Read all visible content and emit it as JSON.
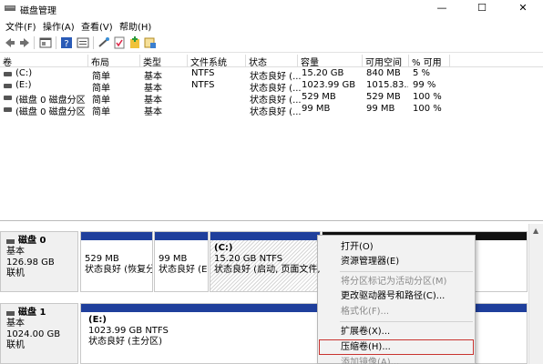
{
  "window": {
    "title": "磁盘管理",
    "controls": {
      "minimize": "—",
      "maximize": "☐",
      "close": "✕"
    }
  },
  "menubar": [
    "文件(F)",
    "操作(A)",
    "查看(V)",
    "帮助(H)"
  ],
  "toolbar_icons": [
    "back-icon",
    "forward-icon",
    "console-icon",
    "help-icon",
    "properties-icon",
    "connect-icon",
    "check-icon",
    "add-icon",
    "settings-icon"
  ],
  "volume_list": {
    "columns": [
      "卷",
      "布局",
      "类型",
      "文件系统",
      "状态",
      "容量",
      "可用空间",
      "% 可用"
    ],
    "rows": [
      {
        "volume": "(C:)",
        "layout": "简单",
        "type": "基本",
        "fs": "NTFS",
        "status": "状态良好 (...",
        "capacity": "15.20 GB",
        "free": "840 MB",
        "pct": "5 %"
      },
      {
        "volume": "(E:)",
        "layout": "简单",
        "type": "基本",
        "fs": "NTFS",
        "status": "状态良好 (...",
        "capacity": "1023.99 GB",
        "free": "1015.83...",
        "pct": "99 %"
      },
      {
        "volume": "(磁盘 0 磁盘分区 1)",
        "layout": "简单",
        "type": "基本",
        "fs": "",
        "status": "状态良好 (...",
        "capacity": "529 MB",
        "free": "529 MB",
        "pct": "100 %"
      },
      {
        "volume": "(磁盘 0 磁盘分区 2)",
        "layout": "简单",
        "type": "基本",
        "fs": "",
        "status": "状态良好 (...",
        "capacity": "99 MB",
        "free": "99 MB",
        "pct": "100 %"
      }
    ]
  },
  "disks": [
    {
      "name": "磁盘 0",
      "type": "基本",
      "size": "126.98 GB",
      "state": "联机",
      "partitions": [
        {
          "line1": "",
          "line2": "529 MB",
          "line3": "状态良好 (恢复分区"
        },
        {
          "line1": "",
          "line2": "99 MB",
          "line3": "状态良好 (EF"
        },
        {
          "line1": "(C:)",
          "line2": "15.20 GB NTFS",
          "line3": "状态良好 (启动, 页面文件, 故"
        }
      ]
    },
    {
      "name": "磁盘 1",
      "type": "基本",
      "size": "1024.00 GB",
      "state": "联机",
      "partitions": [
        {
          "line1": "(E:)",
          "line2": "1023.99 GB NTFS",
          "line3": "状态良好 (主分区)"
        }
      ]
    }
  ],
  "context_menu": {
    "items": [
      {
        "label": "打开(O)",
        "disabled": false
      },
      {
        "label": "资源管理器(E)",
        "disabled": false
      },
      {
        "label": "将分区标记为活动分区(M)",
        "disabled": true
      },
      {
        "label": "更改驱动器号和路径(C)...",
        "disabled": false
      },
      {
        "label": "格式化(F)...",
        "disabled": true
      },
      {
        "label": "扩展卷(X)...",
        "disabled": false
      },
      {
        "label": "压缩卷(H)...",
        "disabled": false,
        "highlighted": true
      },
      {
        "label": "添加镜像(A)...",
        "disabled": true
      }
    ]
  },
  "colors": {
    "partition_bar": "#1f3f9c",
    "highlight_outline": "#c8332f"
  }
}
